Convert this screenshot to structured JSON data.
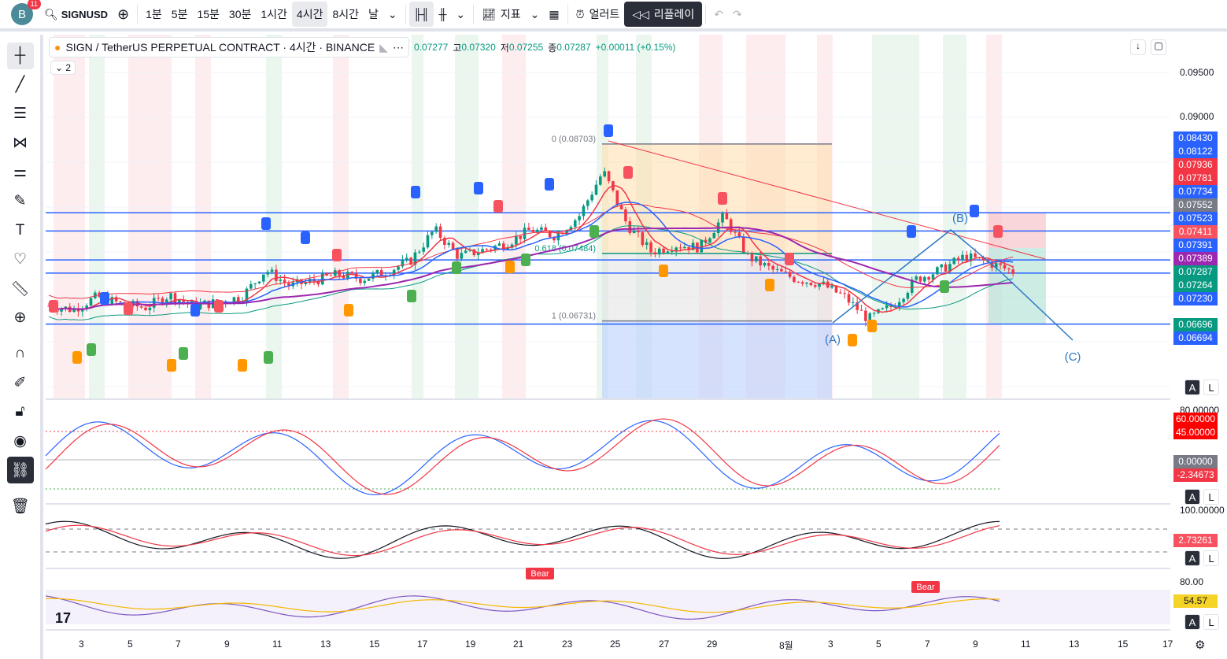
{
  "toolbar": {
    "avatar": "B",
    "notifications": "11",
    "symbol": "SIGNUSD",
    "intervals": [
      "1분",
      "5분",
      "15분",
      "30분",
      "1시간",
      "4시간",
      "8시간",
      "날"
    ],
    "active_interval": "4시간",
    "indicators": "지표",
    "alerts": "얼러트",
    "replay": "리플레이"
  },
  "legend": {
    "title": "SIGN / TetherUS PERPETUAL CONTRACT · 4시간 · BINANCE",
    "open_label": "",
    "open": "0.07277",
    "high_label": "고",
    "high": "0.07320",
    "low_label": "저",
    "low": "0.07255",
    "close_label": "종",
    "close": "0.07287",
    "change": "+0.00011 (+0.15%)",
    "collapsed_count": "2"
  },
  "price_axis": {
    "ticks": [
      "0.09500",
      "0.09000"
    ],
    "labels": [
      {
        "v": "0.08430",
        "c": "#2962ff"
      },
      {
        "v": "0.08122",
        "c": "#2962ff"
      },
      {
        "v": "0.07936",
        "c": "#f23645"
      },
      {
        "v": "0.07781",
        "c": "#f23645"
      },
      {
        "v": "0.07734",
        "c": "#2962ff"
      },
      {
        "v": "0.07552",
        "c": "#787b86"
      },
      {
        "v": "0.07523",
        "c": "#2962ff"
      },
      {
        "v": "0.07411",
        "c": "#f7525f"
      },
      {
        "v": "0.07391",
        "c": "#2962ff"
      },
      {
        "v": "0.07389",
        "c": "#9c27b0"
      },
      {
        "v": "0.07287",
        "c": "#089981"
      },
      {
        "v": "0.07264",
        "c": "#089981"
      },
      {
        "v": "0.07230",
        "c": "#2962ff"
      },
      {
        "v": "0.06696",
        "c": "#089981"
      },
      {
        "v": "0.06694",
        "c": "#2962ff"
      }
    ]
  },
  "levels": [
    0.07936,
    0.07734,
    0.07411,
    0.07264,
    0.06696
  ],
  "fib": {
    "l0": "0 (0.08703)",
    "l618": "0.618 (0.07484)",
    "l1": "1 (0.06731)",
    "p0": 0.08703,
    "p618": 0.07484,
    "p1": 0.06731
  },
  "waves": [
    "(A)",
    "(B)",
    "(C)"
  ],
  "closes": [
    0.069,
    0.0686,
    0.07,
    0.0692,
    0.0688,
    0.0702,
    0.069,
    0.0694,
    0.07,
    0.073,
    0.0712,
    0.0718,
    0.0725,
    0.072,
    0.0728,
    0.074,
    0.0775,
    0.0745,
    0.0752,
    0.076,
    0.0775,
    0.0768,
    0.079,
    0.084,
    0.078,
    0.075,
    0.0758,
    0.0755,
    0.079,
    0.0745,
    0.073,
    0.072,
    0.0715,
    0.07,
    0.0675,
    0.069,
    0.072,
    0.073,
    0.0745,
    0.0738,
    0.0728
  ],
  "pane1": {
    "ticks": [
      "80.00000"
    ],
    "labels": [
      {
        "v": "60.00000",
        "c": "#ff0000"
      },
      {
        "v": "45.00000",
        "c": "#ff0000"
      },
      {
        "v": "0.00000",
        "c": "#787b86"
      },
      {
        "v": "-2.34673",
        "c": "#f23645"
      }
    ]
  },
  "pane2": {
    "ticks": [
      "100.00000"
    ],
    "labels": [
      {
        "v": "2.73261",
        "c": "#f7525f"
      }
    ]
  },
  "pane3": {
    "ticks": [
      "80.00"
    ],
    "labels": [
      {
        "v": "54.57",
        "c": "#f5d327"
      }
    ],
    "bear": "Bear"
  },
  "autolog": {
    "a": "A",
    "l": "L"
  },
  "time_axis": [
    "3",
    "5",
    "7",
    "9",
    "11",
    "13",
    "15",
    "17",
    "19",
    "21",
    "23",
    "25",
    "27",
    "29",
    "8월",
    "3",
    "5",
    "7",
    "9",
    "11",
    "13",
    "15",
    "17"
  ]
}
